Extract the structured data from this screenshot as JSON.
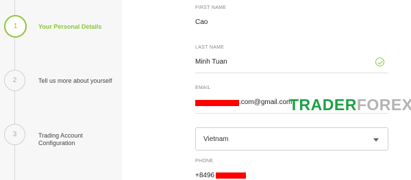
{
  "steps": [
    {
      "number": "1",
      "label": "Your Personal Details",
      "active": true
    },
    {
      "number": "2",
      "label": "Tell us more about yourself",
      "active": false
    },
    {
      "number": "3",
      "label": "Trading Account Configuration",
      "active": false
    }
  ],
  "fields": {
    "first_name": {
      "label": "FIRST NAME",
      "value": "Cao"
    },
    "last_name": {
      "label": "LAST NAME",
      "value": "Minh Tuan"
    },
    "email": {
      "label": "EMAIL",
      "value": ".com@gmail.com"
    },
    "country": {
      "value": "Vietnam"
    },
    "phone": {
      "label": "PHONE",
      "value": "+8496"
    }
  },
  "watermark": {
    "part1": "TRADER",
    "part2": "FOREX"
  },
  "colors": {
    "accent": "#8cc63f",
    "redaction": "#ff0000",
    "watermark_green": "#1ea045"
  }
}
